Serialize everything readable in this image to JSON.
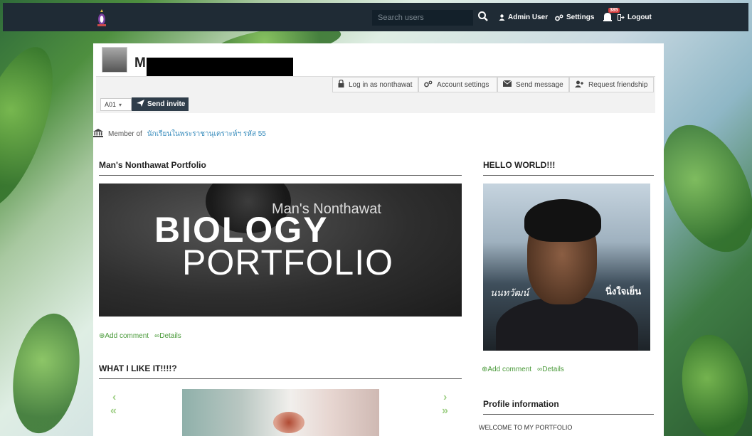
{
  "topbar": {
    "search_placeholder": "Search users",
    "user_label": "Admin User",
    "settings_label": "Settings",
    "notifications_count": "385",
    "logout_label": "Logout"
  },
  "profile": {
    "name_visible": "M",
    "actions": {
      "login_as": "Log in as nonthawat",
      "account_settings": "Account settings",
      "send_message": "Send message",
      "request_friendship": "Request friendship"
    },
    "group_select_value": "A01",
    "send_invite_label": "Send invite",
    "member_prefix": "Member of",
    "member_group": "นักเรียนในพระราชานุเคราะห์ฯ รหัส 55"
  },
  "widgets": {
    "portfolio": {
      "title": "Man's Nonthawat Portfolio",
      "banner_line1": "Man's Nonthawat",
      "banner_line2": "BIOLOGY",
      "banner_line3": "PORTFOLIO",
      "add_comment": "Add comment",
      "details": "Details"
    },
    "hello": {
      "title": "HELLO WORLD!!!",
      "caption_left": "นนทวัฒน์",
      "caption_right": "นิ่งใจเย็น",
      "add_comment": "Add comment",
      "details": "Details"
    },
    "likes": {
      "title": "WHAT I LIKE IT!!!!?"
    },
    "profile_info": {
      "title": "Profile information",
      "text": "WELCOME TO MY PORTFOLIO"
    }
  },
  "colors": {
    "topbar": "#1f2b35",
    "link": "#3a8dbd",
    "green_link": "#4a9a3a",
    "invite_button": "#2f3d4a"
  },
  "icons": [
    "search-icon",
    "user-icon",
    "gear-icon",
    "bell-icon",
    "logout-icon",
    "lock-icon",
    "envelope-icon",
    "user-plus-icon",
    "paper-plane-icon",
    "bank-icon",
    "plus-circle-icon",
    "link-icon",
    "chevron-left-icon",
    "chevron-right-icon"
  ]
}
